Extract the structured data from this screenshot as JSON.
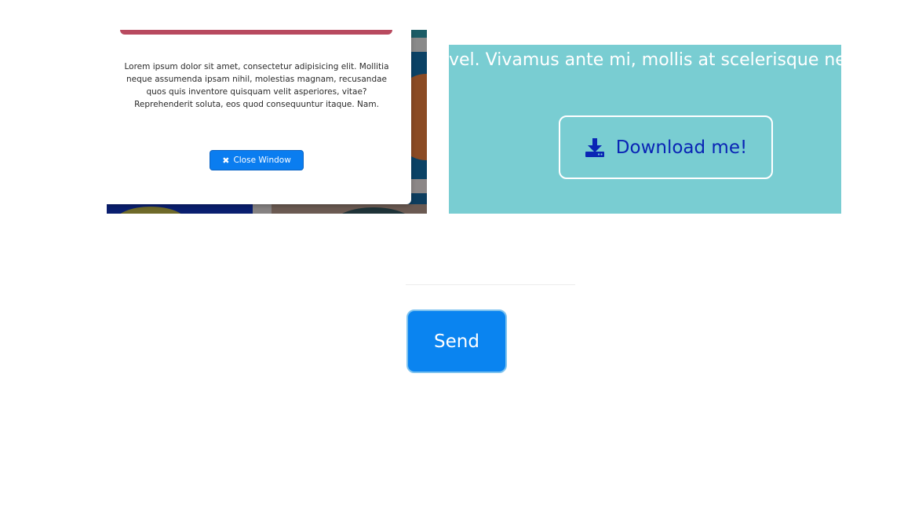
{
  "modal": {
    "text": "Lorem ipsum dolor sit amet, consectetur adipisicing elit. Mollitia neque assumenda ipsam nihil, molestias magnam, recusandae quos quis inventore quisquam velit asperiores, vitae? Reprehenderit soluta, eos quod consequuntur itaque. Nam.",
    "close_label": "Close Window",
    "close_icon": "close-icon",
    "accent_color": "#b84a5f",
    "button_color": "#0a7df0"
  },
  "promo": {
    "marquee_text": "vel. Vivamus ante mi, mollis at scelerisque nec,",
    "download_label": "Download me!",
    "download_icon": "download-icon",
    "background_color": "#79cdd2",
    "text_color": "#0a25b5"
  },
  "form": {
    "send_label": "Send",
    "button_color": "#0a84f0"
  }
}
